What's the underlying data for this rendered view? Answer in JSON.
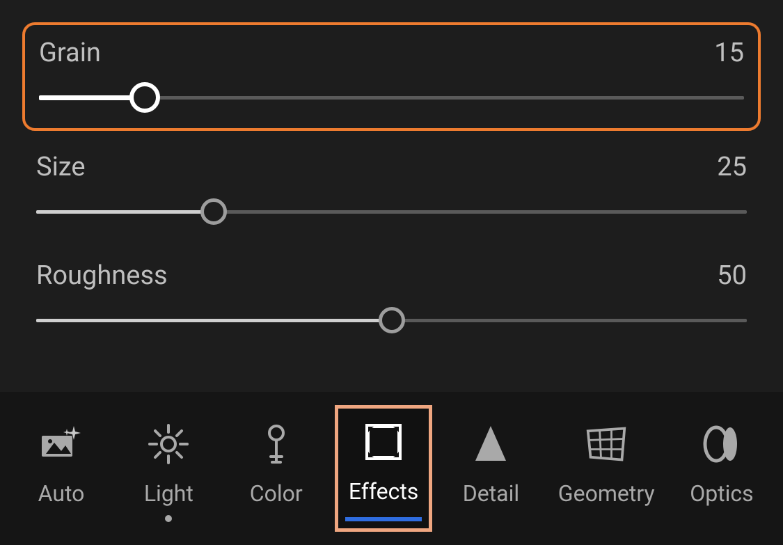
{
  "sliders": [
    {
      "label": "Grain",
      "value": 15,
      "value_text": "15",
      "percent": 15,
      "highlighted": true
    },
    {
      "label": "Size",
      "value": 25,
      "value_text": "25",
      "percent": 25,
      "highlighted": false
    },
    {
      "label": "Roughness",
      "value": 50,
      "value_text": "50",
      "percent": 50,
      "highlighted": false
    }
  ],
  "tabs": [
    {
      "label": "Auto",
      "icon": "auto-icon",
      "selected": false,
      "highlighted": false,
      "has_dot": false
    },
    {
      "label": "Light",
      "icon": "light-icon",
      "selected": false,
      "highlighted": false,
      "has_dot": true
    },
    {
      "label": "Color",
      "icon": "color-icon",
      "selected": false,
      "highlighted": false,
      "has_dot": false
    },
    {
      "label": "Effects",
      "icon": "effects-icon",
      "selected": true,
      "highlighted": true,
      "has_dot": false
    },
    {
      "label": "Detail",
      "icon": "detail-icon",
      "selected": false,
      "highlighted": false,
      "has_dot": false
    },
    {
      "label": "Geometry",
      "icon": "geometry-icon",
      "selected": false,
      "highlighted": false,
      "has_dot": false
    },
    {
      "label": "Optics",
      "icon": "optics-icon",
      "selected": false,
      "highlighted": false,
      "has_dot": false
    }
  ],
  "colors": {
    "highlight_orange": "#ed7b2f",
    "highlight_peach": "#efa680",
    "indicator_blue": "#2f6de0"
  }
}
